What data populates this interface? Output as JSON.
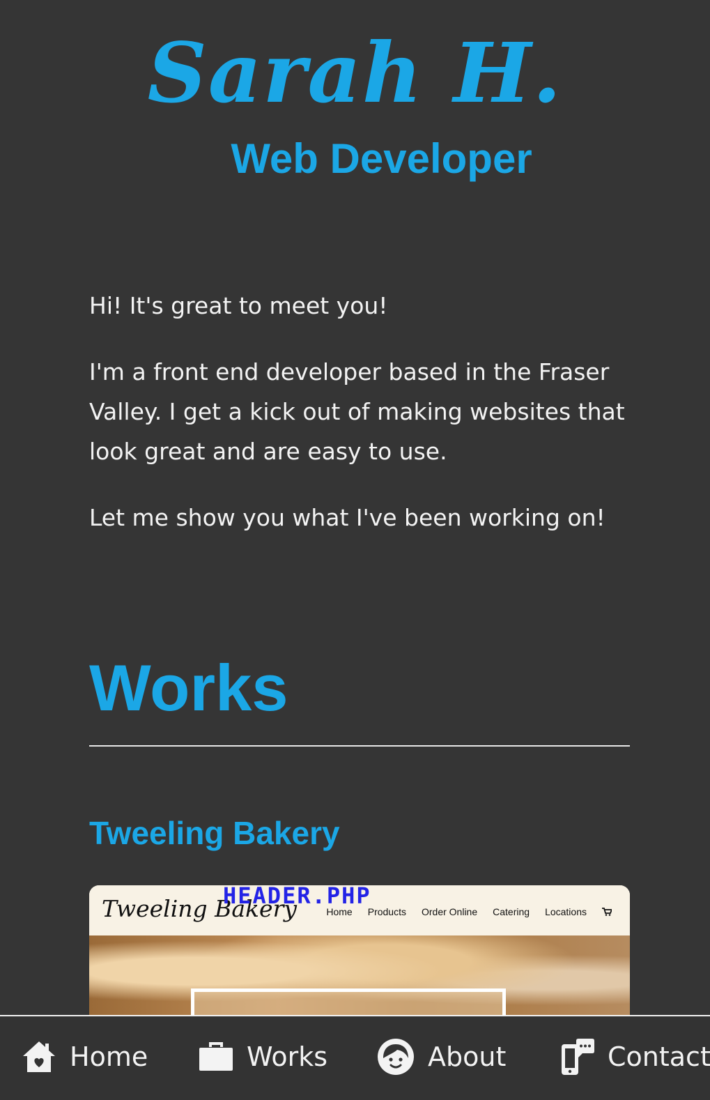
{
  "hero": {
    "name": "Sarah H.",
    "role": "Web Developer"
  },
  "intro": {
    "paragraphs": [
      "Hi! It's great to meet you!",
      "I'm a front end developer based in the Fraser Valley. I get a kick out of making websites that look great and are easy to use.",
      "Let me show you what I've been working on!"
    ]
  },
  "works": {
    "heading": "Works",
    "projects": [
      {
        "title": "Tweeling Bakery",
        "screenshot": {
          "brand": "Tweeling Bakery",
          "overlay_text": "HEADER.PHP",
          "nav": [
            "Home",
            "Products",
            "Order Online",
            "Catering",
            "Locations"
          ],
          "cart_icon": "cart-icon"
        }
      }
    ]
  },
  "bottom_nav": {
    "items": [
      {
        "label": "Home",
        "icon": "house-heart-icon"
      },
      {
        "label": "Works",
        "icon": "briefcase-icon"
      },
      {
        "label": "About",
        "icon": "face-icon"
      },
      {
        "label": "Contact",
        "icon": "phone-chat-icon"
      }
    ]
  },
  "colors": {
    "background": "#353535",
    "accent": "#1ba7e6",
    "text": "#f3f3f3"
  }
}
